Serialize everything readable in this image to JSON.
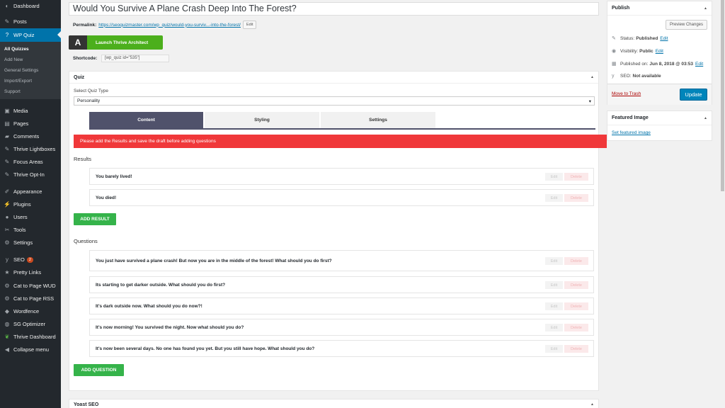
{
  "sidebar": {
    "items": [
      {
        "label": "Dashboard",
        "icon": "dashboard-icon"
      },
      {
        "label": "Posts",
        "icon": "pin-icon"
      },
      {
        "label": "WP Quiz",
        "icon": "help-icon"
      },
      {
        "label": "Media",
        "icon": "media-icon"
      },
      {
        "label": "Pages",
        "icon": "pages-icon"
      },
      {
        "label": "Comments",
        "icon": "comments-icon"
      },
      {
        "label": "Thrive Lightboxes",
        "icon": "pin-icon"
      },
      {
        "label": "Focus Areas",
        "icon": "pin-icon"
      },
      {
        "label": "Thrive Opt-In",
        "icon": "pin-icon"
      },
      {
        "label": "Appearance",
        "icon": "appearance-icon"
      },
      {
        "label": "Plugins",
        "icon": "plugins-icon"
      },
      {
        "label": "Users",
        "icon": "users-icon"
      },
      {
        "label": "Tools",
        "icon": "tools-icon"
      },
      {
        "label": "Settings",
        "icon": "settings-icon"
      },
      {
        "label": "SEO",
        "icon": "yoast-icon",
        "badge": "2"
      },
      {
        "label": "Pretty Links",
        "icon": "link-icon"
      },
      {
        "label": "Cat to Page WUD",
        "icon": "gear-icon"
      },
      {
        "label": "Cat to Page RSS",
        "icon": "gear-icon"
      },
      {
        "label": "Wordfence",
        "icon": "shield-icon"
      },
      {
        "label": "SG Optimizer",
        "icon": "optimizer-icon"
      },
      {
        "label": "Thrive Dashboard",
        "icon": "leaf-icon"
      },
      {
        "label": "Collapse menu",
        "icon": "collapse-icon"
      }
    ],
    "submenu": [
      "All Quizzes",
      "Add New",
      "General Settings",
      "Import/Export",
      "Support"
    ]
  },
  "post": {
    "title": "Would You Survive A Plane Crash Deep Into The Forest?",
    "permalink_label": "Permalink:",
    "permalink_url": "https://seoquizmaster.com/wp_quiz/would-you-surviv...-into-the-forest/",
    "permalink_edit": "Edit",
    "thrive_button": "Launch Thrive Architect",
    "thrive_logo": "A",
    "shortcode_label": "Shortcode:",
    "shortcode_value": "[wp_quiz id=\"535\"]"
  },
  "quiz": {
    "box_title": "Quiz",
    "type_label": "Select Quiz Type",
    "type_value": "Personality",
    "tabs": [
      "Content",
      "Styling",
      "Settings"
    ],
    "alert": "Please add the Results and save the draft before adding questions",
    "results_label": "Results",
    "results": [
      "You barely lived!",
      "You died!"
    ],
    "add_result": "ADD RESULT",
    "questions_label": "Questions",
    "questions": [
      "You just have survived a plane crash! But now you are in the middle of the forest! What should you do first?",
      "Its starting to get darker outside. What should you do first?",
      "It's dark outside now. What should you do now?!",
      "It's now morning! You survived the night. Now what should you do?",
      "It's now been several days. No one has found you yet. But you still have hope. What should you do?"
    ],
    "add_question": "ADD QUESTION",
    "edit_label": "Edit",
    "delete_label": "Delete"
  },
  "yoast": {
    "title": "Yoast SEO"
  },
  "publish": {
    "title": "Publish",
    "preview": "Preview Changes",
    "status_label": "Status:",
    "status_value": "Published",
    "visibility_label": "Visibility:",
    "visibility_value": "Public",
    "published_label": "Published on:",
    "published_value": "Jun 8, 2018 @ 03:53",
    "seo_label": "SEO:",
    "seo_value": "Not available",
    "edit": "Edit",
    "trash": "Move to Trash",
    "update": "Update"
  },
  "featured": {
    "title": "Featured Image",
    "link": "Set featured image"
  },
  "colors": {
    "sidebar": "#23282d",
    "active": "#0073aa",
    "tab_active": "#50526b",
    "alert": "#f0383a",
    "green": "#35b34a",
    "update": "#0085ba"
  }
}
